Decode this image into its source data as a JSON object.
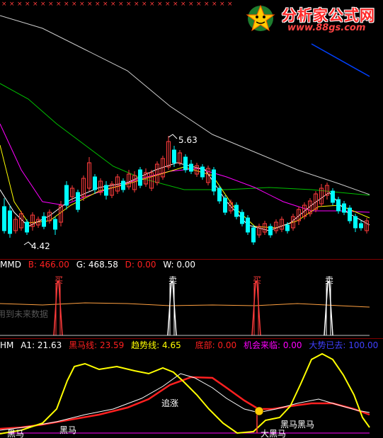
{
  "logo": {
    "text": "分析家公式网",
    "url": "www.88gs.com"
  },
  "main": {
    "high_label": "5.63",
    "low_label": "4.42"
  },
  "mmd": {
    "name": "MMD",
    "b": "B: 466.00",
    "g": "G: 468.58",
    "d": "D: 0.00",
    "w": "W: 0.00",
    "buy_label": "买",
    "sell_label": "卖",
    "watermark": "用到未来数据"
  },
  "hm": {
    "name": "HM",
    "a1": "A1: 21.63",
    "hmx": "黑马线: 23.59",
    "qsx": "趋势线: 4.65",
    "db": "底部: 0.00",
    "jhll": "机会来临: 0.00",
    "dsyq": "大势已去: 100.00",
    "ann_heima1": "黑马",
    "ann_heima2": "黑马",
    "ann_zhuizhang": "追涨",
    "ann_daheima": "大黑马",
    "ann_heimaheima": "黑马黑马"
  },
  "colors": {
    "up": "#ff3b3b",
    "down": "#00ffff",
    "ma5": "#ffffff",
    "ma10": "#ffff00",
    "ma20": "#ff00ff",
    "ma30": "#00c000",
    "ma60": "#cccccc",
    "ma120": "#0040ff",
    "b": "#ff2020",
    "g": "#ffffff",
    "d": "#ff2020",
    "a1": "#ffffff",
    "hmx": "#ff2020",
    "qsx": "#ffff00",
    "db": "#ff2020",
    "jhll": "#ff00ff",
    "dsyq": "#4040ff"
  },
  "icons": {
    "logo": "star-logo-icon",
    "smiley": "smiley-icon"
  }
}
